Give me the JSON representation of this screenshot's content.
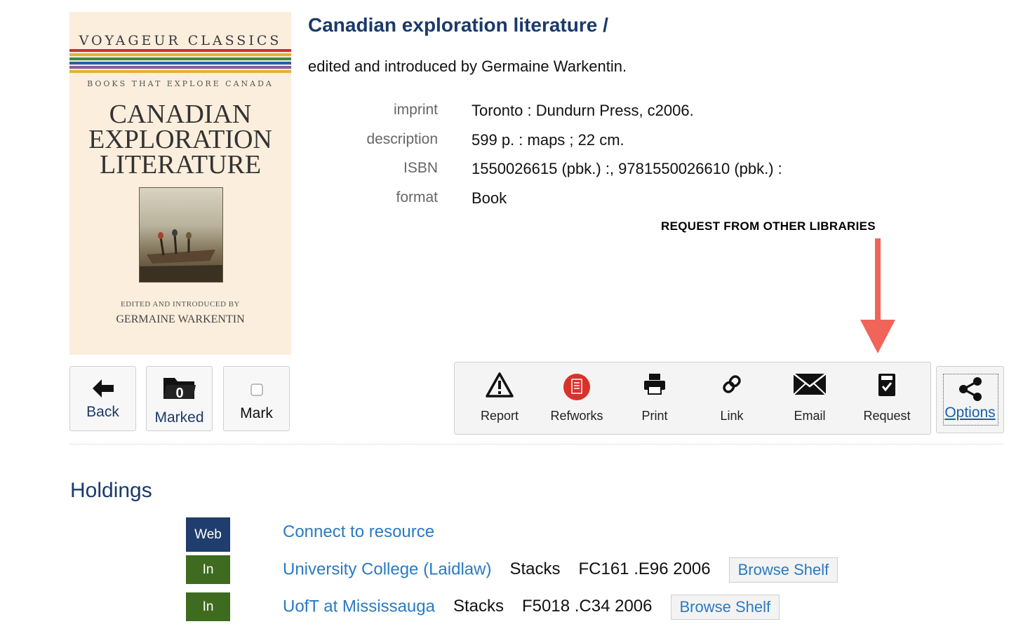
{
  "cover": {
    "series": "VOYAGEUR CLASSICS",
    "tagline": "BOOKS THAT EXPLORE CANADA",
    "title": "CANADIAN\nEXPLORATION\nLITERATURE",
    "byline": "EDITED AND INTRODUCED BY",
    "author": "GERMAINE WARKENTIN",
    "stripe_colors": [
      "#c7342c",
      "#e6b032",
      "#3b8a4a",
      "#2a5ea8",
      "#8a5a9c"
    ]
  },
  "record": {
    "title": "Canadian exploration literature /",
    "statement": "edited and introduced by Germaine Warkentin.",
    "fields": [
      {
        "label": "imprint",
        "value": "Toronto : Dundurn Press, c2006."
      },
      {
        "label": "description",
        "value": "599 p. : maps ; 22 cm."
      },
      {
        "label": "ISBN",
        "value": "1550026615 (pbk.) :, 9781550026610 (pbk.) :"
      },
      {
        "label": "format",
        "value": "Book"
      }
    ]
  },
  "annotation": {
    "text": "REQUEST FROM OTHER LIBRARIES",
    "color": "#f0645a"
  },
  "nav_buttons": {
    "back": "Back",
    "marked": "Marked",
    "marked_count": "0",
    "mark": "Mark"
  },
  "toolbar": {
    "report": "Report",
    "refworks": "Refworks",
    "print": "Print",
    "link": "Link",
    "email": "Email",
    "request": "Request",
    "options": "Options"
  },
  "holdings": {
    "heading": "Holdings",
    "rows": [
      {
        "badge": "Web",
        "link": "Connect to resource"
      },
      {
        "badge": "In",
        "link": "University College (Laidlaw)",
        "location": "Stacks",
        "call_number": "FC161 .E96 2006",
        "shelf": "Browse Shelf"
      },
      {
        "badge": "In",
        "link": "UofT at Mississauga",
        "location": "Stacks",
        "call_number": "F5018 .C34 2006",
        "shelf": "Browse Shelf"
      }
    ]
  },
  "colors": {
    "title": "#1a3a6b",
    "link": "#2a7ac2",
    "badge_web": "#1f3d6e",
    "badge_in": "#3e6b1f"
  }
}
